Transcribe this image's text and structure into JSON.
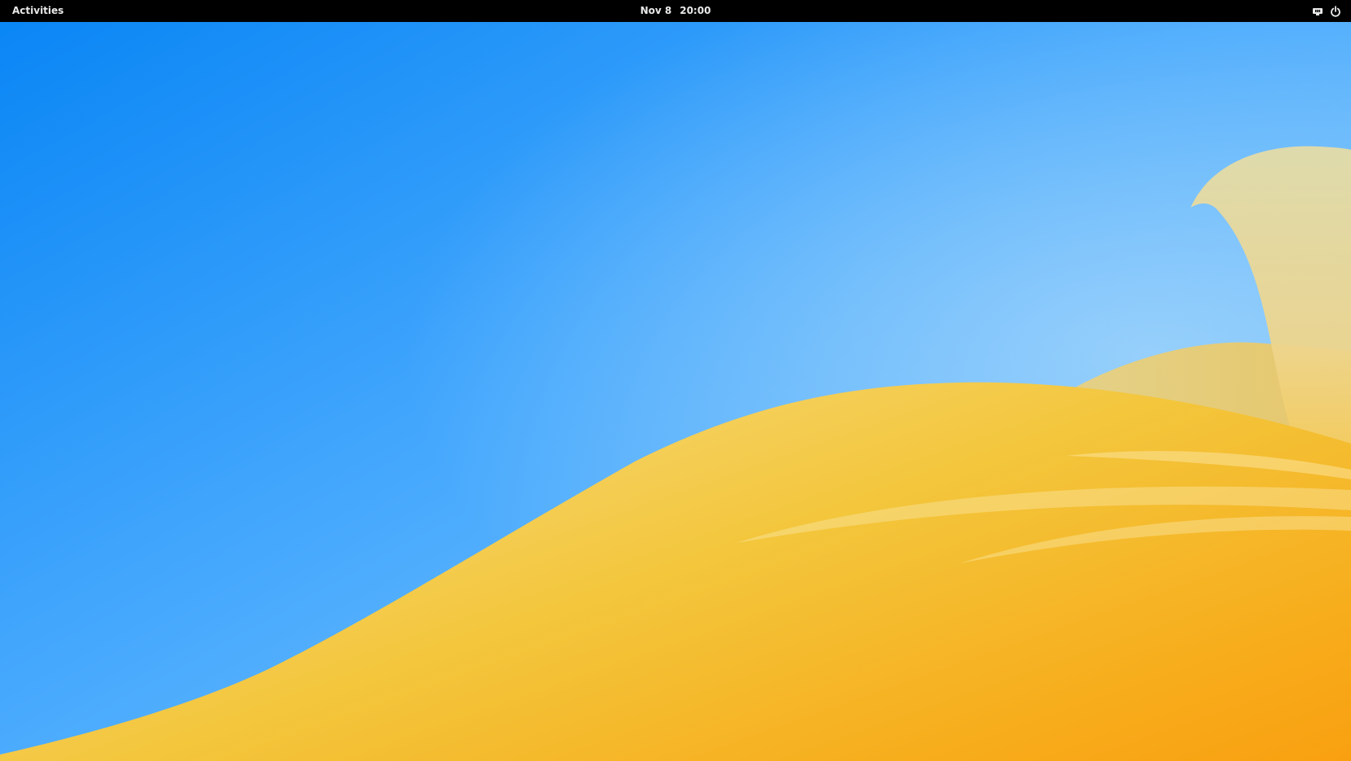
{
  "topbar": {
    "activities_label": "Activities",
    "date": "Nov 8",
    "time": "20:00",
    "status_icons": [
      "network-wired-icon",
      "power-icon"
    ]
  },
  "wallpaper": {
    "sky_colors": [
      "#0a86f5",
      "#45a8fd",
      "#8ccbfb"
    ],
    "hill_colors": [
      "#f6d36e",
      "#f3c23a",
      "#f9a412"
    ],
    "back_leaf_color": "#e4d9a2"
  }
}
